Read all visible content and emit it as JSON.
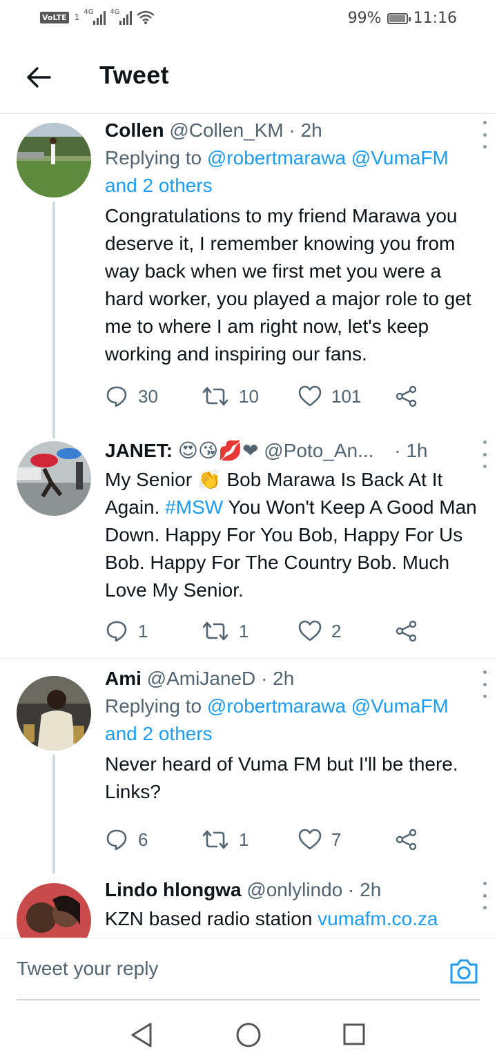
{
  "status_bar": {
    "network_badge": "VoLTE",
    "sim": "1",
    "sig1": "4G",
    "sig2": "4G",
    "battery": "99%",
    "time": "11:16"
  },
  "header": {
    "title": "Tweet"
  },
  "tweets": [
    {
      "name": "Collen",
      "handle": "@Collen_KM",
      "time": "· 2h",
      "replying_prefix": "Replying to ",
      "replying_to": "@robertmarawa @VumaFM",
      "replying_others": "and 2 others",
      "text": "Congratulations to my friend Marawa you deserve it, I remember knowing you from way back when we first met you were a hard worker, you played a major role to get me to where I am right now, let's keep working and inspiring our fans.",
      "replies": "30",
      "retweets": "10",
      "likes": "101"
    },
    {
      "name": "JANET:",
      "name_emoji": "😍😘💋❤",
      "handle": "@Poto_An...",
      "time": "· 1h",
      "text_1": "My Senior ",
      "text_emoji": "👏",
      "text_2": " Bob Marawa Is Back At It Again.  ",
      "hashtag": "#MSW",
      "text_3": " You Won't Keep A Good Man Down. Happy For You Bob, Happy For Us Bob. Happy For The Country Bob. Much Love My Senior.",
      "replies": "1",
      "retweets": "1",
      "likes": "2"
    },
    {
      "name": "Ami",
      "handle": "@AmiJaneD",
      "time": "· 2h",
      "replying_prefix": "Replying to ",
      "replying_to": "@robertmarawa @VumaFM",
      "replying_others": "and 2 others",
      "text": "Never heard of Vuma FM but I'll be there. Links?",
      "replies": "6",
      "retweets": "1",
      "likes": "7"
    },
    {
      "name": "Lindo hlongwa",
      "handle": "@onlylindo",
      "time": "· 2h",
      "text": "KZN based radio station ",
      "link": "vumafm.co.za"
    }
  ],
  "reply_bar": {
    "placeholder": "Tweet your reply"
  },
  "colors": {
    "accent": "#1d9bf0",
    "secondary_text": "#536471",
    "primary_text": "#0f1419"
  },
  "icons": [
    "back-arrow-icon",
    "more-vertical-icon",
    "reply-icon",
    "retweet-icon",
    "like-icon",
    "share-icon",
    "camera-icon",
    "nav-back-icon",
    "nav-home-icon",
    "nav-recents-icon"
  ]
}
